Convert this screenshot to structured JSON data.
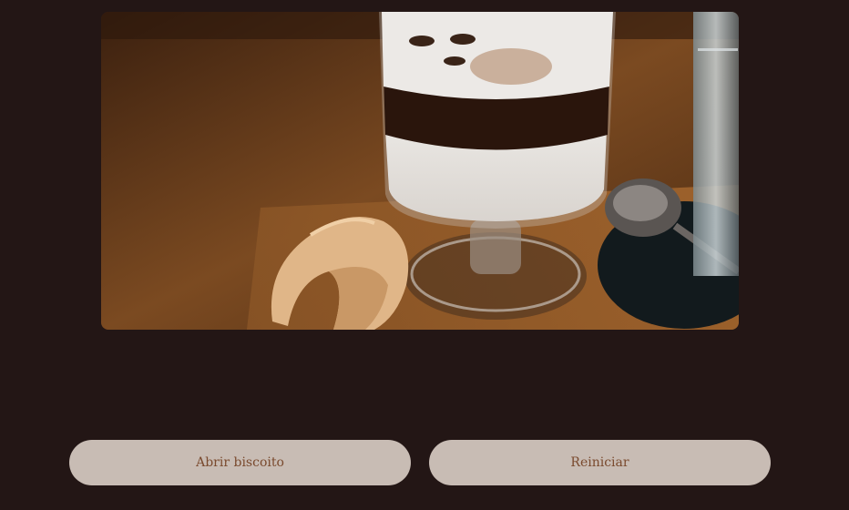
{
  "hero_image": {
    "icon": "coffee-and-fortune-cookie-photo"
  },
  "actions": {
    "open_label": "Abrir biscoito",
    "reset_label": "Reiniciar"
  },
  "colors": {
    "background": "#231615",
    "button_bg": "#c8bcb4",
    "button_text": "#7a4a2e"
  }
}
